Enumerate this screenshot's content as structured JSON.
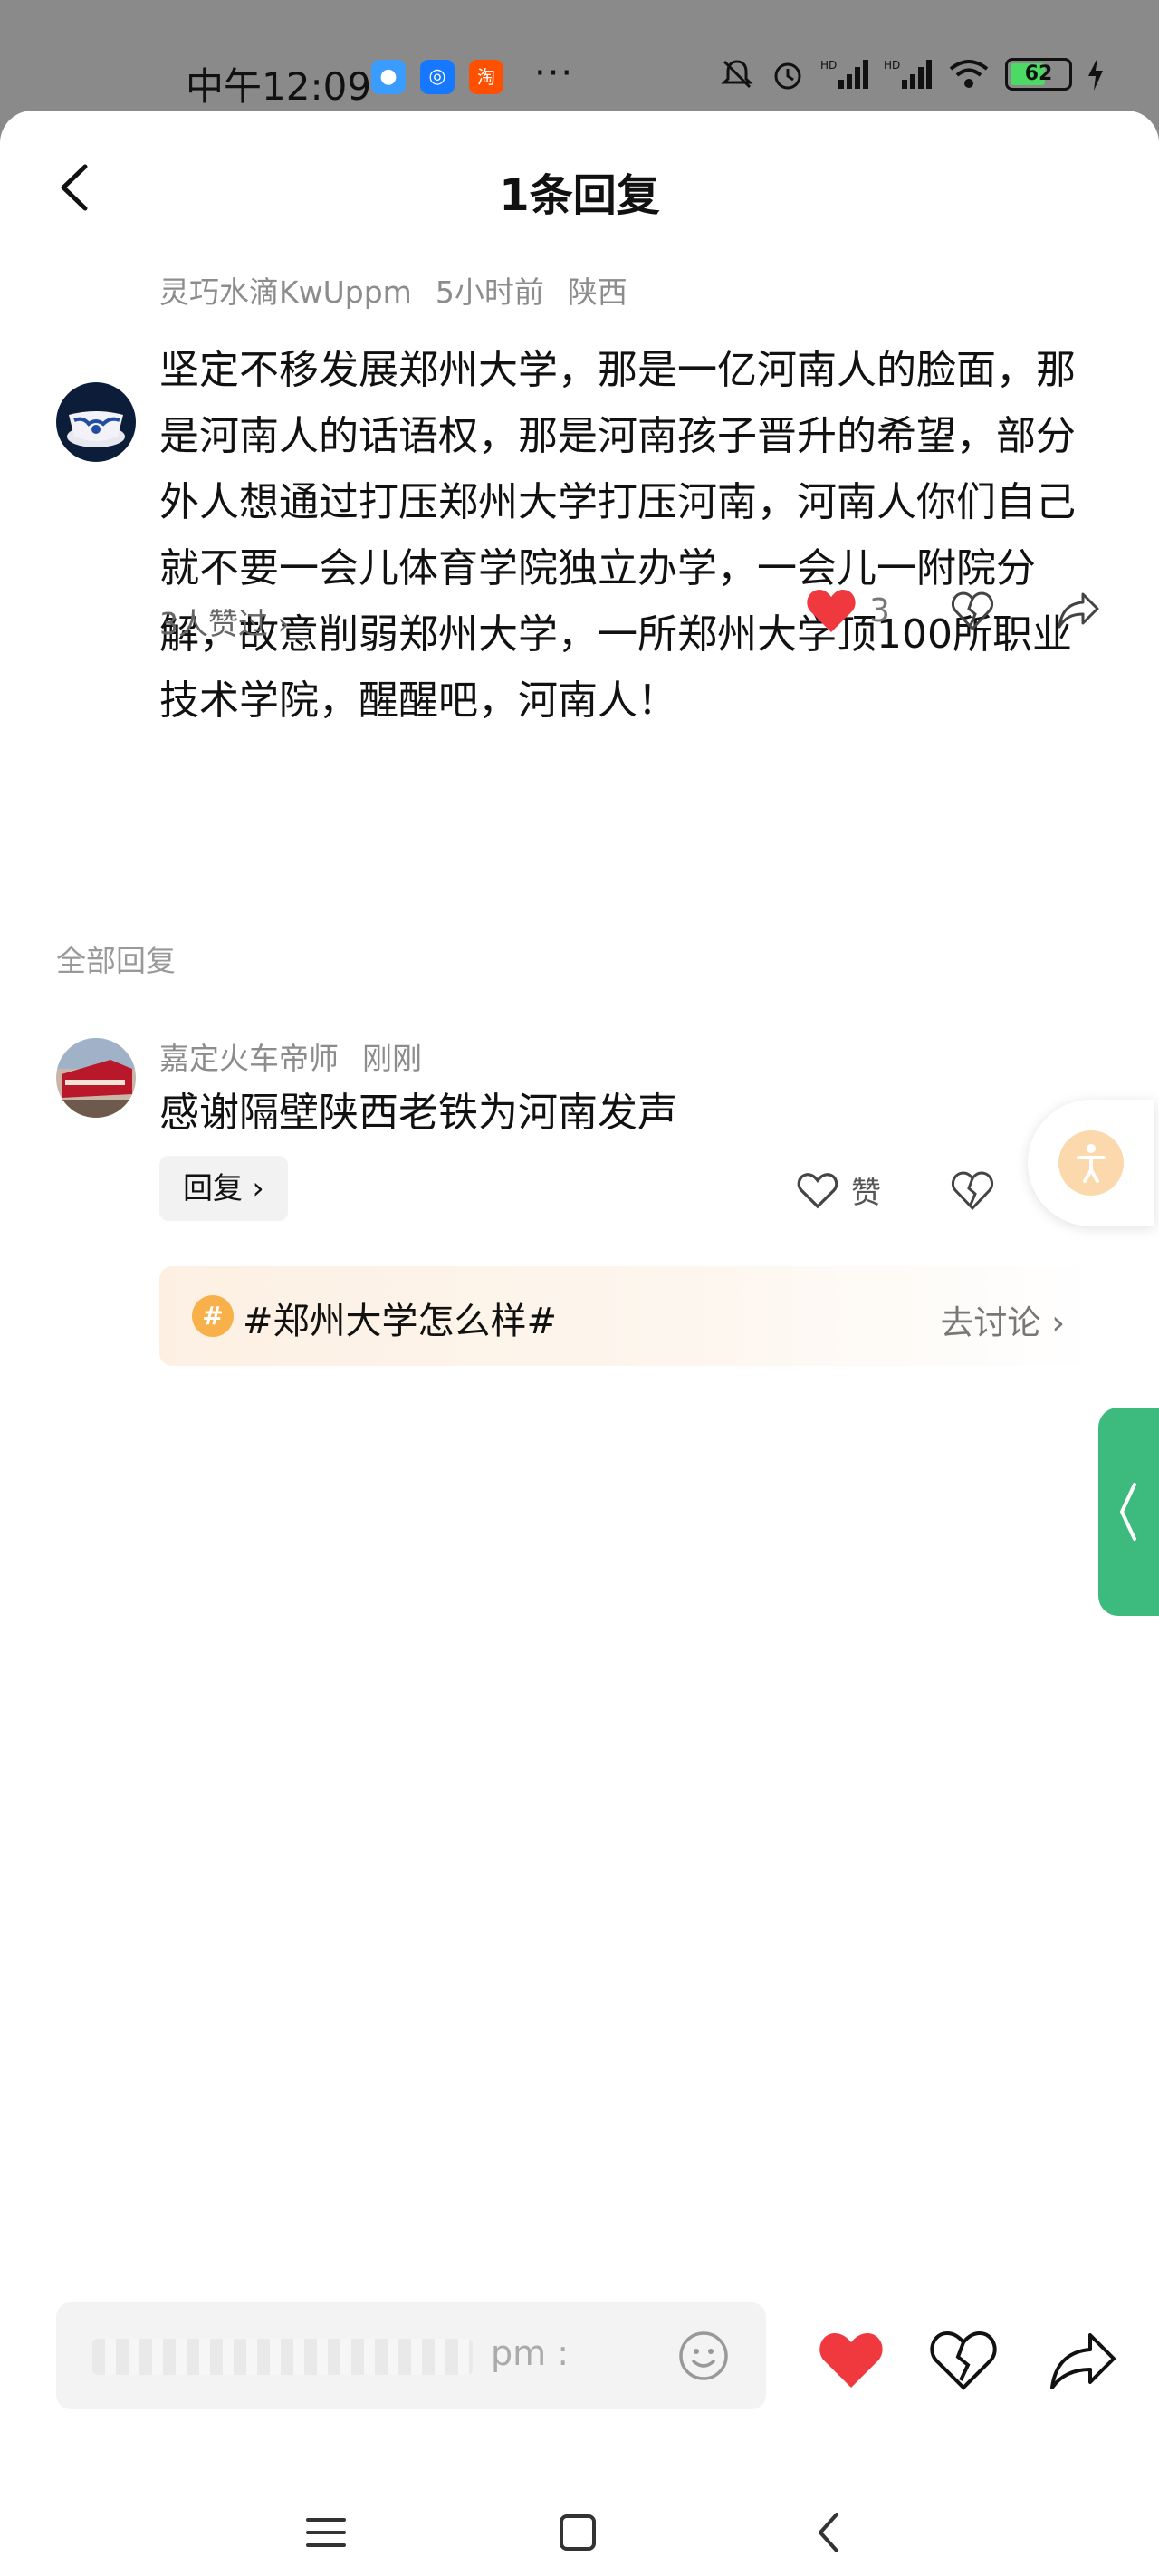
{
  "status_bar": {
    "time": "中午12:09",
    "apps": [
      {
        "name": "message-app-icon",
        "color": "#3b9cff",
        "glyph": "●"
      },
      {
        "name": "alipay-app-icon",
        "color": "#1677ff",
        "glyph": "◎"
      },
      {
        "name": "taobao-app-icon",
        "color": "#ff5000",
        "glyph": "淘"
      }
    ],
    "more": "···",
    "battery": "62",
    "battery_level": 0.62
  },
  "header": {
    "title": "1条回复"
  },
  "main_comment": {
    "user": "灵巧水滴KwUppm",
    "time": "5小时前",
    "location": "陕西",
    "text": "坚定不移发展郑州大学，那是一亿河南人的脸面，那是河南人的话语权，那是河南孩子晋升的希望，部分外人想通过打压郑州大学打压河南，河南人你们自己就不要一会儿体育学院独立办学，一会儿一附院分解，故意削弱郑州大学，一所郑州大学顶100所职业技术学院，醒醒吧，河南人！",
    "likers": "3人赞过 ›",
    "like_count": "3"
  },
  "all_replies_label": "全部回复",
  "reply": {
    "user": "嘉定火车帝师",
    "time": "刚刚",
    "text": "感谢隔壁陕西老铁为河南发声",
    "reply_button": "回复 ›",
    "like_label": "赞"
  },
  "topic": {
    "icon": "#",
    "label": "#郑州大学怎么样#",
    "discuss": "去讨论 ›"
  },
  "input": {
    "placeholder": "pm :"
  },
  "colors": {
    "like_red": "#f0393f",
    "side_tab_green": "#3dba7e",
    "topic_orange": "#f8b14a"
  }
}
